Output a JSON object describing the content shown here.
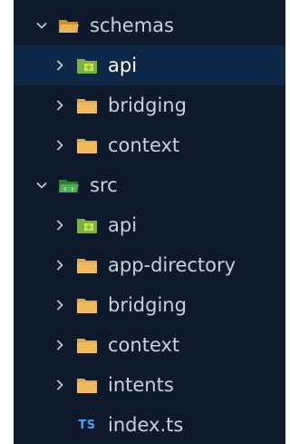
{
  "explorer": {
    "items": [
      {
        "label": "schemas",
        "depth": 0,
        "expanded": true,
        "icon": "folder-open-icon"
      },
      {
        "label": "api",
        "depth": 1,
        "expanded": false,
        "icon": "folder-api-icon",
        "selected": true
      },
      {
        "label": "bridging",
        "depth": 1,
        "expanded": false,
        "icon": "folder-icon"
      },
      {
        "label": "context",
        "depth": 1,
        "expanded": false,
        "icon": "folder-icon"
      },
      {
        "label": "src",
        "depth": 0,
        "expanded": true,
        "icon": "folder-src-open-icon"
      },
      {
        "label": "api",
        "depth": 1,
        "expanded": false,
        "icon": "folder-api-icon"
      },
      {
        "label": "app-directory",
        "depth": 1,
        "expanded": false,
        "icon": "folder-icon"
      },
      {
        "label": "bridging",
        "depth": 1,
        "expanded": false,
        "icon": "folder-icon"
      },
      {
        "label": "context",
        "depth": 1,
        "expanded": false,
        "icon": "folder-icon"
      },
      {
        "label": "intents",
        "depth": 1,
        "expanded": false,
        "icon": "folder-icon"
      },
      {
        "label": "index.ts",
        "depth": 1,
        "icon": "typescript-file-icon",
        "badge": "TS"
      }
    ]
  },
  "colors": {
    "background": "#0e1a2b",
    "selected_row": "#0f2847",
    "text": "#c9d1d9",
    "folder": "#e0a84a",
    "folder_api": "#8bc34a",
    "folder_src": "#4caf50",
    "typescript": "#3fa6f7"
  }
}
